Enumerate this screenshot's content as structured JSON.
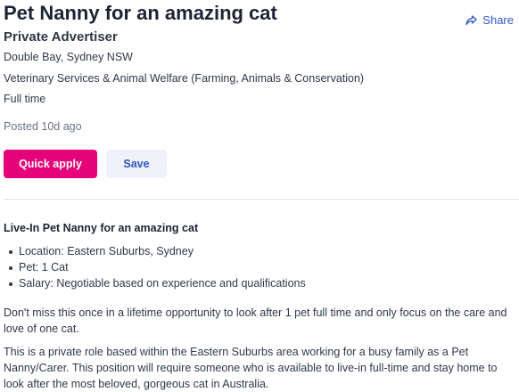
{
  "job": {
    "title": "Pet Nanny for an amazing cat",
    "advertiser": "Private Advertiser",
    "location": "Double Bay, Sydney NSW",
    "category": "Veterinary Services & Animal Welfare (Farming, Animals & Conservation)",
    "work_type": "Full time",
    "posted": "Posted 10d ago"
  },
  "actions": {
    "share_label": "Share",
    "quick_apply_label": "Quick apply",
    "save_label": "Save"
  },
  "colors": {
    "primary_button": "#e60278",
    "link_blue": "#2f56c4",
    "save_bg": "#eef1f8"
  },
  "description": {
    "heading": "Live-In Pet Nanny for an amazing cat",
    "bullets": [
      "Location: Eastern Suburbs, Sydney",
      "Pet: 1 Cat",
      "Salary: Negotiable based on experience and qualifications"
    ],
    "paragraphs": [
      "Don't miss this once in a lifetime opportunity to look after 1 pet full time and only focus on the care and love of one cat.",
      "This is a private role based within the Eastern Suburbs area working for a busy family as a Pet Nanny/Carer. This position will require someone who is available to live-in full-time and stay home to look after the most beloved, gorgeous cat in Australia."
    ]
  }
}
